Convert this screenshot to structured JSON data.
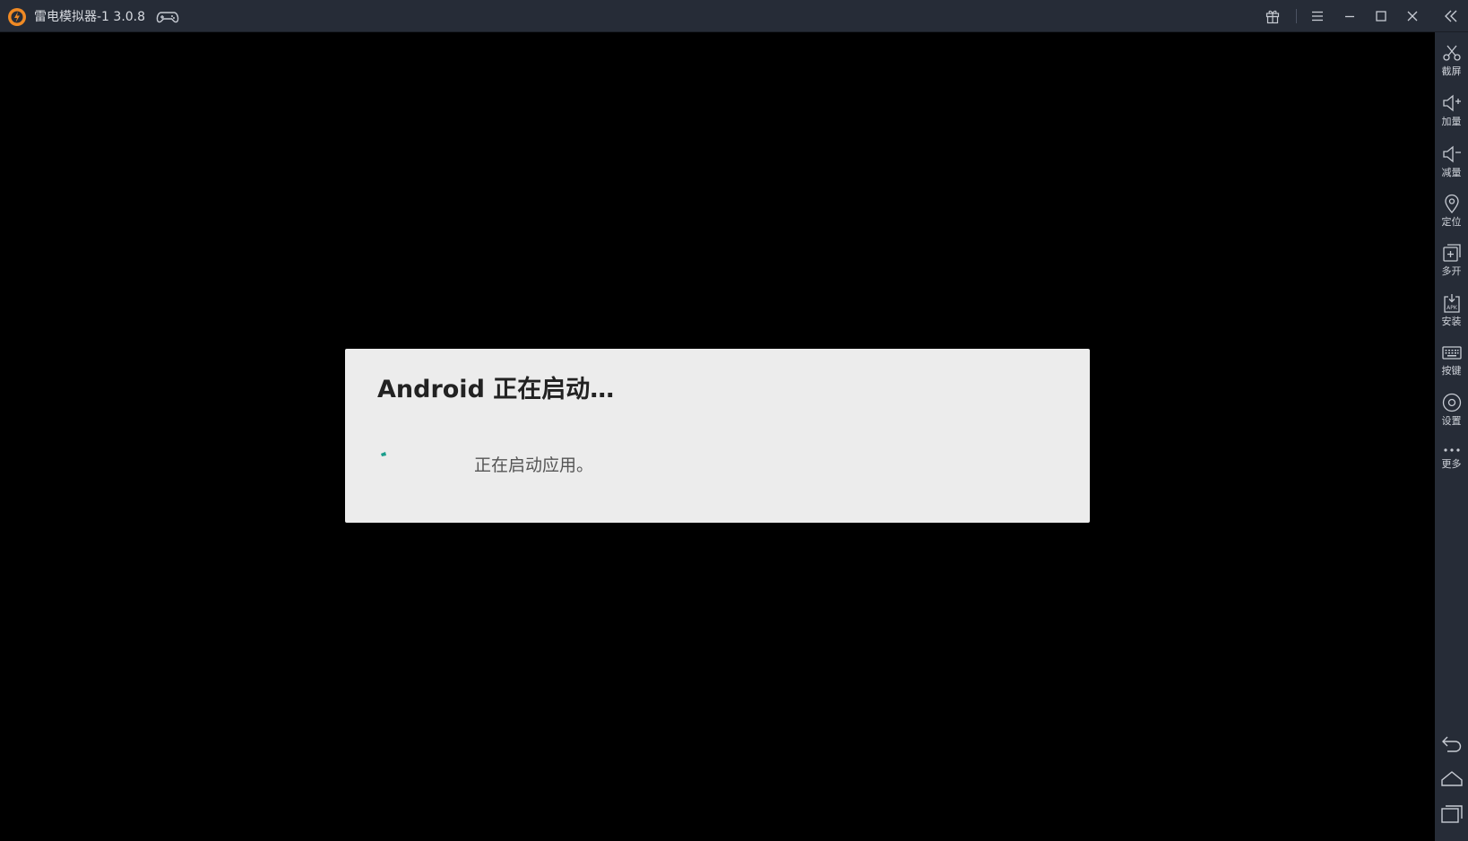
{
  "window": {
    "title": "雷电模拟器-1 3.0.8",
    "colors": {
      "titlebar": "#262c37",
      "sidebar": "#262c37",
      "icon": "#c7cbd3",
      "logo": "#f08a24",
      "accent": "#1a9e8c"
    }
  },
  "titlebar": {
    "icons": [
      "gamepad-icon",
      "gift-icon",
      "menu-icon",
      "minimize-icon",
      "maximize-icon",
      "close-icon",
      "collapse-sidebar-icon"
    ]
  },
  "sidebar": {
    "items": [
      {
        "icon": "scissors-icon",
        "label": "截屏"
      },
      {
        "icon": "volume-up-icon",
        "label": "加量"
      },
      {
        "icon": "volume-down-icon",
        "label": "减量"
      },
      {
        "icon": "location-icon",
        "label": "定位"
      },
      {
        "icon": "multi-open-icon",
        "label": "多开"
      },
      {
        "icon": "apk-install-icon",
        "label": "安装"
      },
      {
        "icon": "keyboard-icon",
        "label": "按键"
      },
      {
        "icon": "settings-icon",
        "label": "设置"
      },
      {
        "icon": "more-icon",
        "label": "更多"
      }
    ],
    "nav": [
      "back-icon",
      "home-icon",
      "recents-icon"
    ]
  },
  "dialog": {
    "title": "Android 正在启动…",
    "message": "正在启动应用。"
  }
}
